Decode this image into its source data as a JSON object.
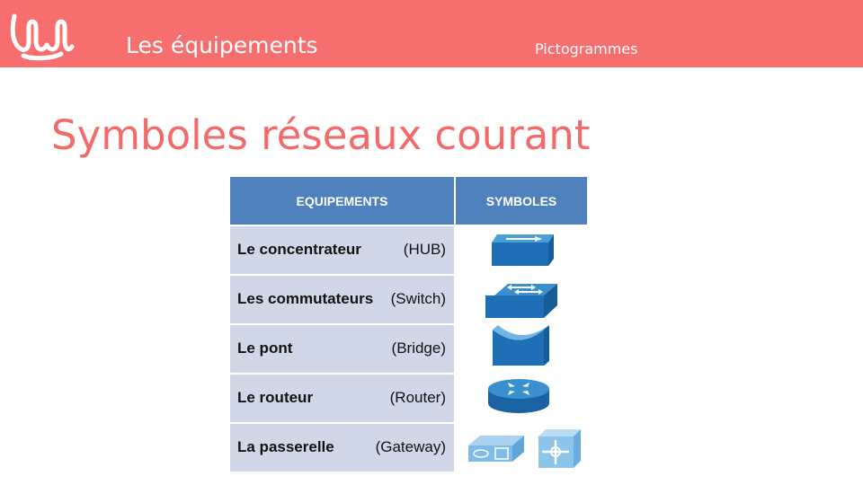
{
  "header": {
    "section_title": "Les équipements",
    "section_subtitle": "Pictogrammes",
    "logo_icon": "waves-logo-icon"
  },
  "slide_title": "Symboles réseaux courant",
  "table": {
    "columns": [
      "EQUIPEMENTS",
      "SYMBOLES"
    ],
    "rows": [
      {
        "name": "Le concentrateur",
        "abbr": "(HUB)",
        "icon": "hub-icon"
      },
      {
        "name": "Les commutateurs",
        "abbr": "(Switch)",
        "icon": "switch-icon"
      },
      {
        "name": "Le pont",
        "abbr": "(Bridge)",
        "icon": "bridge-icon"
      },
      {
        "name": "Le routeur",
        "abbr": "(Router)",
        "icon": "router-icon"
      },
      {
        "name": "La passerelle",
        "abbr": "(Gateway)",
        "icon": "gateway-icon"
      }
    ]
  },
  "colors": {
    "accent": "#f76e6e",
    "header_blue": "#4f81bd",
    "row_fill": "#d0d8e8",
    "icon_blue": "#1e6fb5"
  }
}
